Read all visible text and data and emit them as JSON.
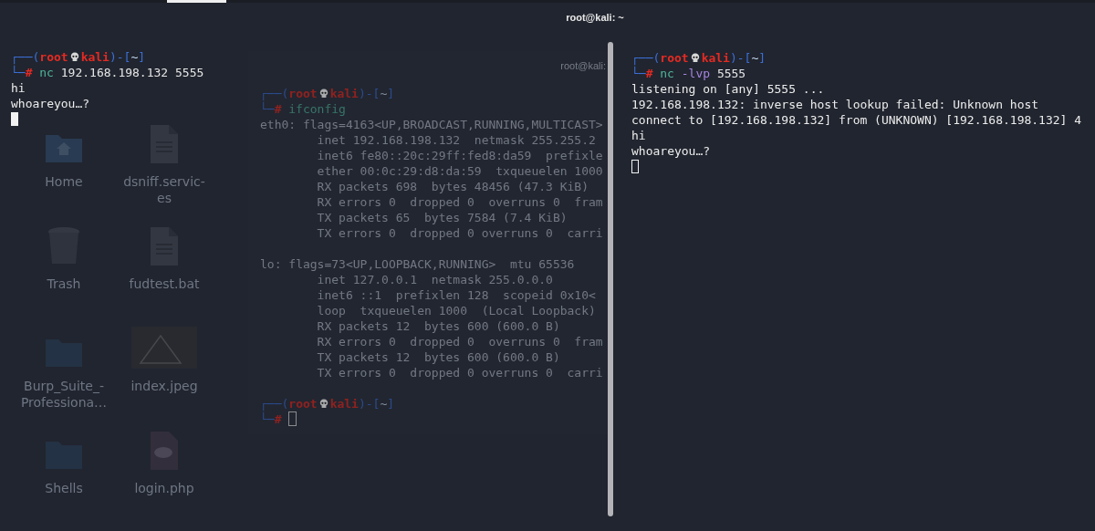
{
  "window": {
    "title": "root@kali: ~"
  },
  "desktop": {
    "icons": [
      {
        "label": "Home",
        "kind": "home-folder"
      },
      {
        "label": "dsniff.servic-es",
        "kind": "document"
      },
      {
        "label": "Trash",
        "kind": "trash"
      },
      {
        "label": "fudtest.bat",
        "kind": "document"
      },
      {
        "label": "Burp_Suite_-Professiona…",
        "kind": "folder"
      },
      {
        "label": "index.jpeg",
        "kind": "image"
      },
      {
        "label": "Shells",
        "kind": "folder"
      },
      {
        "label": "login.php",
        "kind": "php"
      }
    ]
  },
  "background_terminal": {
    "title": "root@kali:",
    "prompt": [
      {
        "text": "┌──(",
        "kind": "frame"
      },
      {
        "text": "root",
        "kind": "user"
      },
      {
        "kind": "skull"
      },
      {
        "text": "kali",
        "kind": "host"
      },
      {
        "text": ")-[",
        "kind": "frame"
      },
      {
        "text": "~",
        "kind": "dir"
      },
      {
        "text": "]",
        "kind": "frame"
      }
    ],
    "command": [
      {
        "text": "└─",
        "kind": "frame"
      },
      {
        "text": "#",
        "kind": "symbol"
      },
      {
        "text": "ifconfig",
        "kind": "program"
      }
    ],
    "lines": [
      "eth0: flags=4163<UP,BROADCAST,RUNNING,MULTICAST>",
      "        inet 192.168.198.132  netmask 255.255.2",
      "        inet6 fe80::20c:29ff:fed8:da59  prefixle",
      "        ether 00:0c:29:d8:da:59  txqueuelen 1000",
      "        RX packets 698  bytes 48456 (47.3 KiB)",
      "        RX errors 0  dropped 0  overruns 0  fram",
      "        TX packets 65  bytes 7584 (7.4 KiB)",
      "        TX errors 0  dropped 0 overruns 0  carri",
      "lo: flags=73<UP,LOOPBACK,RUNNING>  mtu 65536",
      "        inet 127.0.0.1  netmask 255.0.0.0",
      "        inet6 ::1  prefixlen 128  scopeid 0x10<",
      "        loop  txqueuelen 1000  (Local Loopback)",
      "        RX packets 12  bytes 600 (600.0 B)",
      "        RX errors 0  dropped 0  overruns 0  fram",
      "        TX packets 12  bytes 600 (600.0 B)",
      "        TX errors 0  dropped 0 overruns 0  carri"
    ],
    "final_prompt": [
      {
        "text": "┌──(",
        "kind": "frame"
      },
      {
        "text": "root",
        "kind": "user"
      },
      {
        "kind": "skull"
      },
      {
        "text": "kali",
        "kind": "host"
      },
      {
        "text": ")-[",
        "kind": "frame"
      },
      {
        "text": "~",
        "kind": "dir"
      },
      {
        "text": "]",
        "kind": "frame"
      }
    ],
    "final_command": [
      {
        "text": "└─",
        "kind": "frame"
      },
      {
        "text": "#",
        "kind": "symbol"
      }
    ]
  },
  "panes": [
    {
      "focused": true,
      "prompt": [
        {
          "text": "┌──(",
          "kind": "frame"
        },
        {
          "text": "root",
          "kind": "user"
        },
        {
          "kind": "skull"
        },
        {
          "text": "kali",
          "kind": "host"
        },
        {
          "text": ")-[",
          "kind": "frame"
        },
        {
          "text": "~",
          "kind": "dir"
        },
        {
          "text": "]",
          "kind": "frame"
        }
      ],
      "command": [
        {
          "text": "└─",
          "kind": "frame"
        },
        {
          "text": "#",
          "kind": "symbol"
        },
        {
          "text": "nc",
          "kind": "program"
        },
        {
          "text": "192.168.198.132",
          "kind": "arg"
        },
        {
          "text": "5555",
          "kind": "arg"
        }
      ],
      "output": [
        "hi",
        "whoareyou…?"
      ]
    },
    {
      "focused": false,
      "prompt": [
        {
          "text": "┌──(",
          "kind": "frame"
        },
        {
          "text": "root",
          "kind": "user"
        },
        {
          "kind": "skull"
        },
        {
          "text": "kali",
          "kind": "host"
        },
        {
          "text": ")-[",
          "kind": "frame"
        },
        {
          "text": "~",
          "kind": "dir"
        },
        {
          "text": "]",
          "kind": "frame"
        }
      ],
      "command": [
        {
          "text": "└─",
          "kind": "frame"
        },
        {
          "text": "#",
          "kind": "symbol"
        },
        {
          "text": "nc",
          "kind": "program"
        },
        {
          "text": "-lvp",
          "kind": "flag"
        },
        {
          "text": "5555",
          "kind": "arg"
        }
      ],
      "output": [
        "listening on [any] 5555 ...",
        "192.168.198.132: inverse host lookup failed: Unknown host",
        "connect to [192.168.198.132] from (UNKNOWN) [192.168.198.132] 4",
        "hi",
        "whoareyou…?"
      ]
    }
  ]
}
